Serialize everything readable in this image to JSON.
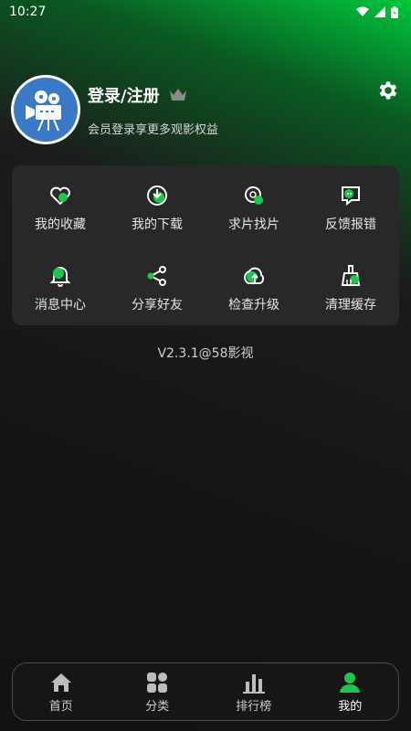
{
  "status_bar": {
    "time": "10:27"
  },
  "profile": {
    "title": "登录/注册",
    "subtitle": "会员登录享更多观影权益"
  },
  "menu": {
    "items": [
      {
        "label": "我的收藏",
        "icon": "heart-icon"
      },
      {
        "label": "我的下载",
        "icon": "download-icon"
      },
      {
        "label": "求片找片",
        "icon": "film-search-icon"
      },
      {
        "label": "反馈报错",
        "icon": "feedback-icon"
      },
      {
        "label": "消息中心",
        "icon": "bell-icon"
      },
      {
        "label": "分享好友",
        "icon": "share-icon"
      },
      {
        "label": "检查升级",
        "icon": "upgrade-icon"
      },
      {
        "label": "清理缓存",
        "icon": "broom-icon"
      }
    ]
  },
  "version": "V2.3.1@58影视",
  "bottom_nav": {
    "items": [
      {
        "label": "首页",
        "icon": "home-icon"
      },
      {
        "label": "分类",
        "icon": "category-icon"
      },
      {
        "label": "排行榜",
        "icon": "ranking-icon"
      },
      {
        "label": "我的",
        "icon": "user-icon",
        "active": true
      }
    ]
  },
  "colors": {
    "accent": "#19c94a",
    "card": "#282828",
    "avatar_bg": "#3a78c8"
  }
}
